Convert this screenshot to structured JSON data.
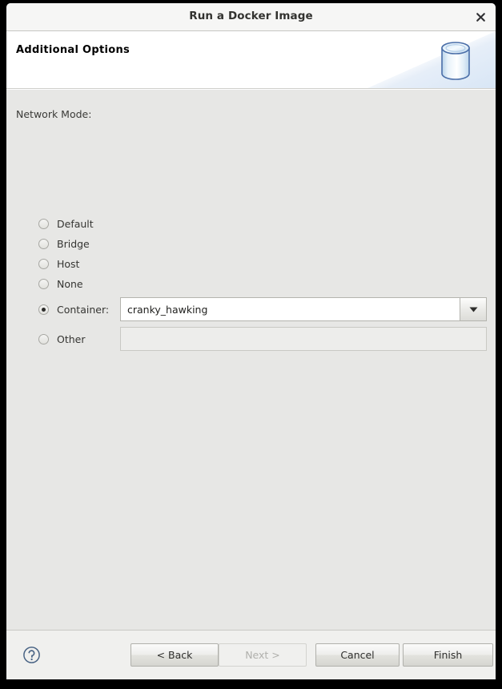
{
  "window": {
    "title": "Run a Docker Image",
    "close_label": "×",
    "close_icon": "close-icon"
  },
  "banner": {
    "heading": "Additional Options",
    "icon": "database-cylinder-icon"
  },
  "form": {
    "group_label": "Network Mode:",
    "options": [
      {
        "id": "default",
        "label": "Default",
        "selected": false
      },
      {
        "id": "bridge",
        "label": "Bridge",
        "selected": false
      },
      {
        "id": "host",
        "label": "Host",
        "selected": false
      },
      {
        "id": "none",
        "label": "None",
        "selected": false
      },
      {
        "id": "container",
        "label": "Container:",
        "selected": true
      },
      {
        "id": "other",
        "label": "Other",
        "selected": false
      }
    ],
    "container_combo": {
      "value": "cranky_hawking",
      "placeholder": "",
      "arrow_icon": "chevron-down-icon",
      "enabled": true
    },
    "other_input": {
      "value": "",
      "placeholder": "",
      "enabled": false
    }
  },
  "footer": {
    "help_icon": "help-question-icon",
    "buttons": [
      {
        "id": "back",
        "label": "< Back",
        "enabled": true
      },
      {
        "id": "next",
        "label": "Next >",
        "enabled": false
      },
      {
        "id": "cancel",
        "label": "Cancel",
        "enabled": true
      },
      {
        "id": "finish",
        "label": "Finish",
        "enabled": true
      }
    ]
  },
  "colors": {
    "window_bg": "#f0f0ef",
    "content_bg": "#e7e7e5",
    "banner_bg": "#ffffff",
    "accent_blue": "#4a6d9e",
    "text": "#353532"
  }
}
